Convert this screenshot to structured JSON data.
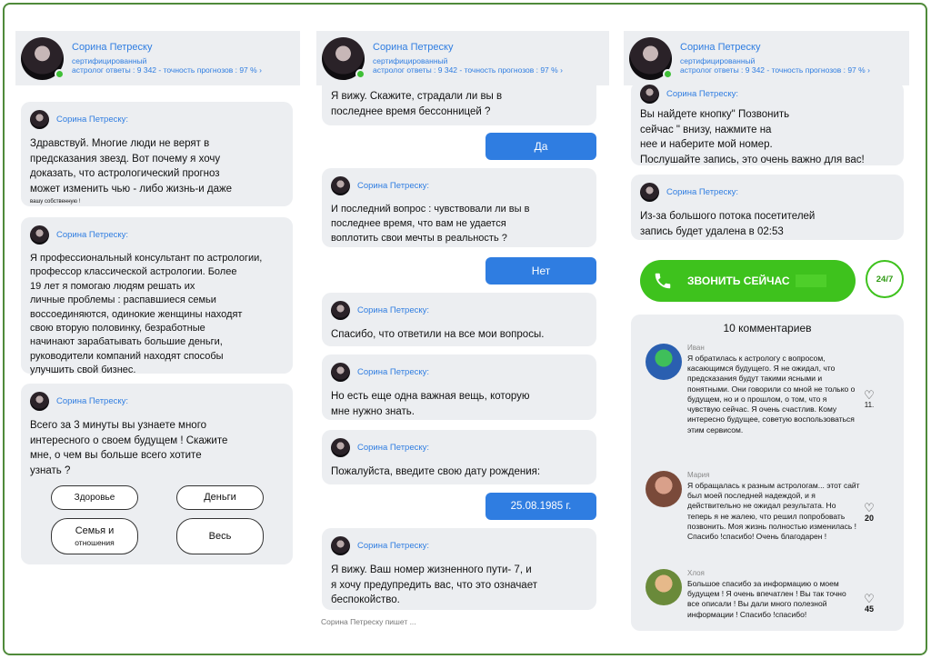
{
  "header": {
    "name": "Сорина Петреску",
    "certified": "сертифицированный",
    "stats": "астролог ответы : 9 342 - точность прогнозов : 97 % ",
    "stats_arrow": "›"
  },
  "sender": "Сорина Петреску:",
  "col1": {
    "msg1": "Здравствуй. Многие люди не верят в\nпредсказания звезд. Вот почему я хочу\nдоказать, что астрологический прогноз\nможет изменить чью - либо жизнь-и даже",
    "msg1_small": "вашу собственную !",
    "msg2": "Я профессиональный консультант по астрологии,\nпрофессор классической астрологии. Более\n19 лет я помогаю людям решать их\nличные проблемы : распавшиеся семьи\nвоссоединяются, одинокие женщины находят\nсвою вторую половинку, безработные\nначинают зарабатывать большие деньги,\nруководители компаний находят способы\nулучшить свой бизнес.",
    "msg3": "Всего за 3 минуты вы узнаете много\nинтересного о своем будущем ! Скажите\nмне, о чем вы больше всего хотите\nузнать ?",
    "options": {
      "health": "Здоровье",
      "money": "Деньги",
      "family_1": "Семья и",
      "family_2": "отношения",
      "all": "Весь"
    }
  },
  "col2": {
    "msg1": "Я вижу. Скажите, страдали ли вы в\nпоследнее время бессонницей ?",
    "ans1": "Да",
    "msg2": "И последний вопрос : чувствовали ли вы в\nпоследнее время, что вам не удается\nвоплотить свои мечты в реальность ?",
    "ans2": "Нет",
    "msg3": "Спасибо, что ответили на все мои вопросы.",
    "msg4": "Но есть еще одна важная вещь, которую\nмне нужно знать.",
    "msg5": "Пожалуйста, введите свою дату рождения:",
    "ans3": "25.08.1985 г.",
    "msg6": "Я вижу. Ваш номер жизненного пути- 7, и\nя хочу предупредить вас, что это означает\nбеспокойство.",
    "typing": "Сорина Петреску пишет ..."
  },
  "col3": {
    "msg1": "Вы найдете кнопку\" Позвонить\nсейчас \" внизу, нажмите на\nнее и наберите мой номер.\nПослушайте запись, это очень важно для вас!",
    "msg2": "Из-за большого потока посетителей\nзапись будет удалена в 02:53",
    "call_button": "ЗВОНИТЬ СЕЙЧАС",
    "badge": "24/7",
    "comments_title": "10 комментариев",
    "comments": [
      {
        "name": "Иван",
        "text": "Я обратилась к астрологу с вопросом, касающимся будущего. Я не ожидал, что предсказания будут такими ясными и понятными. Они говорили со мной не только о будущем, но и о прошлом, о том, что я чувствую сейчас. Я очень счастлив. Кому интересно будущее, советую воспользоваться этим сервисом.",
        "likes": "11."
      },
      {
        "name": "Мария",
        "text": "Я обращалась к разным астрологам... этот сайт был моей последней надеждой, и я действительно не ожидал результата. Но теперь я не жалею, что решил попробовать позвонить. Моя жизнь полностью изменилась ! Спасибо !спасибо! Очень благодарен !",
        "likes": "20"
      },
      {
        "name": "Хлоя",
        "text": "Большое спасибо за информацию о моем будущем ! Я очень впечатлен ! Вы так точно все описали ! Вы дали много полезной информации ! Спасибо !спасибо!",
        "likes": "45"
      }
    ]
  },
  "colors": {
    "accent": "#2f7de1",
    "bubble": "#eceef1",
    "call_green": "#3ec21d",
    "frame_green": "#4f8a3a"
  },
  "icons": [
    "online-dot-icon",
    "phone-icon",
    "heart-icon"
  ]
}
